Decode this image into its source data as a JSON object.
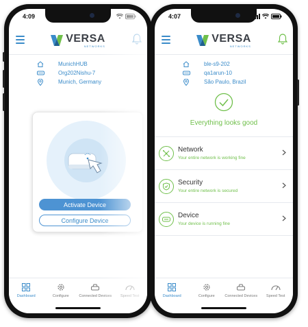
{
  "left_phone": {
    "status_time": "4:09",
    "brand": {
      "name": "VERSA",
      "sub": "NETWORKS"
    },
    "info": [
      {
        "icon": "home-icon",
        "text": "MunichHUB"
      },
      {
        "icon": "router-icon",
        "text": "Org202Nishu-7"
      },
      {
        "icon": "location-pin-icon",
        "text": "Munich, Germany"
      }
    ],
    "card": {
      "primary_button": "Activate Device",
      "secondary_button": "Configure Device"
    },
    "tabs": [
      {
        "label": "Dashboard",
        "icon": "dashboard-icon",
        "active": true
      },
      {
        "label": "Configure",
        "icon": "gear-icon",
        "active": false
      },
      {
        "label": "Connected Devices",
        "icon": "devices-icon",
        "active": false
      },
      {
        "label": "Speed Test",
        "icon": "speedometer-icon",
        "active": false
      }
    ]
  },
  "right_phone": {
    "status_time": "4:07",
    "brand": {
      "name": "VERSA",
      "sub": "NETWORKS"
    },
    "info": [
      {
        "icon": "home-icon",
        "text": "ble-s9-202"
      },
      {
        "icon": "router-icon",
        "text": "qa1arun-10"
      },
      {
        "icon": "location-pin-icon",
        "text": "São Paulo, Brazil"
      }
    ],
    "good_message": "Everything looks good",
    "items": [
      {
        "title": "Network",
        "subtitle": "Your entire network is working fine",
        "icon": "network-icon"
      },
      {
        "title": "Security",
        "subtitle": "Your entire network is secured",
        "icon": "shield-icon"
      },
      {
        "title": "Device",
        "subtitle": "Your device is running fine",
        "icon": "device-icon"
      }
    ],
    "tabs": [
      {
        "label": "Dashboard",
        "icon": "dashboard-icon",
        "active": true
      },
      {
        "label": "Configure",
        "icon": "gear-icon",
        "active": false
      },
      {
        "label": "Connected Devices",
        "icon": "devices-icon",
        "active": false
      },
      {
        "label": "Speed Test",
        "icon": "speedometer-icon",
        "active": false
      }
    ]
  },
  "colors": {
    "brand_blue": "#3a8bc9",
    "ok_green": "#6fbf4a",
    "button_blue": "#4d93d3"
  }
}
